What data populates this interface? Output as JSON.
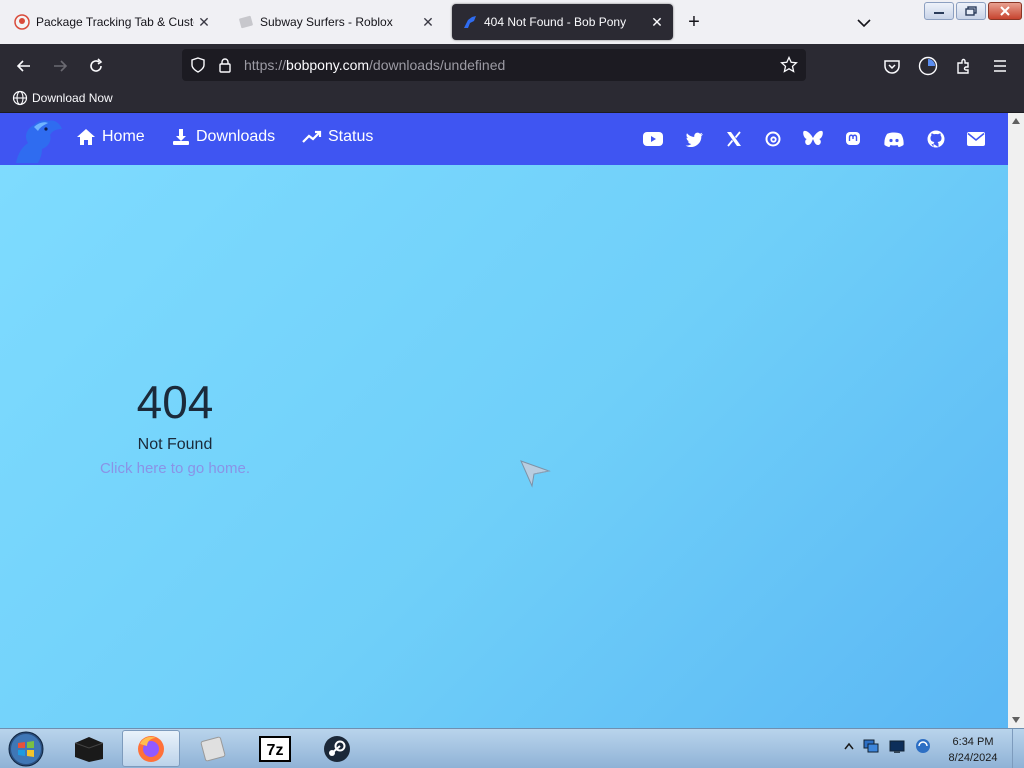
{
  "browser": {
    "tabs": [
      {
        "title": "Package Tracking Tab & Custom",
        "active": false
      },
      {
        "title": "Subway Surfers - Roblox",
        "active": false
      },
      {
        "title": "404 Not Found - Bob Pony",
        "active": true
      }
    ],
    "new_tab_label": "+",
    "close_glyph": "✕",
    "url": {
      "scheme": "https://",
      "domain": "bobpony.com",
      "path": "/downloads/undefined"
    },
    "bookmarks": [
      {
        "label": "Download Now",
        "icon": "globe-icon"
      }
    ]
  },
  "site": {
    "brand_color": "#3f55f2",
    "nav_links": [
      {
        "label": "Home",
        "icon": "home-icon"
      },
      {
        "label": "Downloads",
        "icon": "download-icon"
      },
      {
        "label": "Status",
        "icon": "trending-up-icon"
      }
    ],
    "social_icons": [
      "youtube-icon",
      "twitter-icon",
      "x-icon",
      "threads-icon",
      "bluesky-icon",
      "mastodon-icon",
      "discord-icon",
      "github-icon",
      "email-icon"
    ],
    "error": {
      "code": "404",
      "message": "Not Found",
      "home_link": "Click here to go home."
    }
  },
  "taskbar": {
    "pinned": [
      "start-orb",
      "terminal",
      "firefox",
      "roblox",
      "7zip",
      "steam"
    ],
    "clock": {
      "time": "6:34 PM",
      "date": "8/24/2024"
    }
  }
}
